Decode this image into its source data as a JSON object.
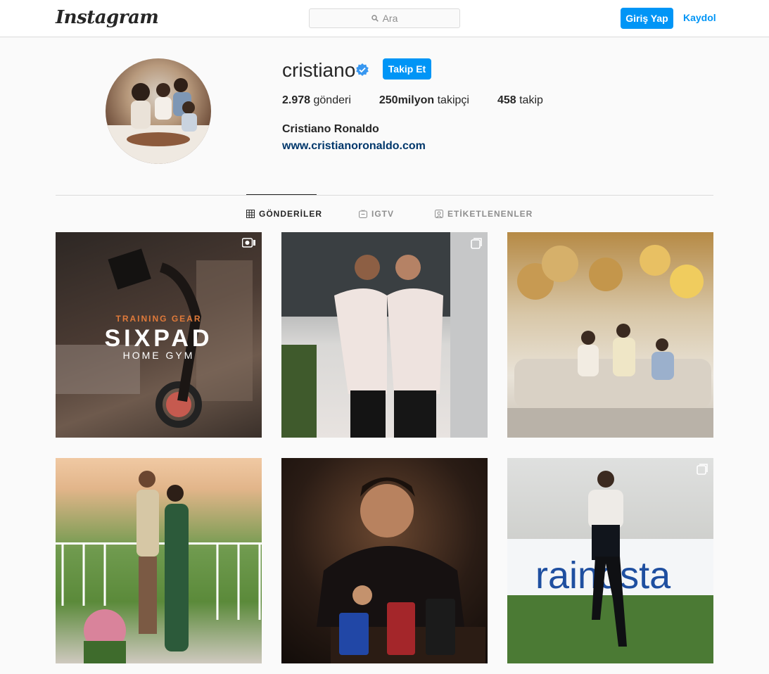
{
  "nav": {
    "logo": "Instagram",
    "search_placeholder": "Ara",
    "login_label": "Giriş Yap",
    "signup_label": "Kaydol"
  },
  "profile": {
    "username": "cristiano",
    "follow_label": "Takip Et",
    "stats": [
      {
        "value": "2.978",
        "label": "gönderi"
      },
      {
        "value": "250milyon",
        "label": "takipçi"
      },
      {
        "value": "458",
        "label": "takip"
      }
    ],
    "full_name": "Cristiano Ronaldo",
    "website": "www.cristianoronaldo.com"
  },
  "tabs": [
    {
      "label": "GÖNDERİLER",
      "icon": "grid-icon",
      "active": true
    },
    {
      "label": "IGTV",
      "icon": "igtv-icon",
      "active": false
    },
    {
      "label": "ETİKETLENENLER",
      "icon": "tagged-icon",
      "active": false
    }
  ],
  "posts": [
    {
      "badge": "igtv-icon",
      "overlay": {
        "small": "TRAINING GEAR",
        "big": "SIXPAD",
        "sub": "HOME GYM"
      }
    },
    {
      "badge": "carousel-icon"
    },
    {
      "badge": ""
    },
    {
      "badge": ""
    },
    {
      "badge": ""
    },
    {
      "badge": "carousel-icon"
    }
  ],
  "colors": {
    "accent": "#0095f6",
    "link": "#00376b",
    "border": "#dbdbdb",
    "background": "#fafafa"
  }
}
